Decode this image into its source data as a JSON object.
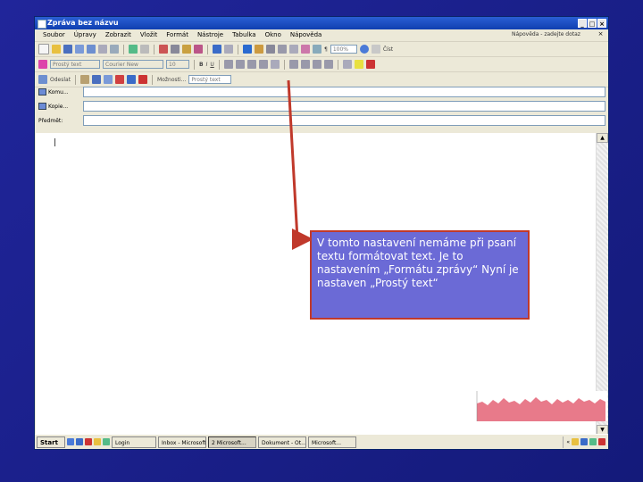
{
  "window": {
    "title": "Zpráva bez názvu",
    "buttons": [
      "_",
      "□",
      "×"
    ]
  },
  "menu": {
    "items": [
      "Soubor",
      "Úpravy",
      "Zobrazit",
      "Vložit",
      "Formát",
      "Nástroje",
      "Tabulka",
      "Okno",
      "Nápověda"
    ],
    "help_box": "Nápověda - zadejte dotaz",
    "close": "×"
  },
  "toolbar_standard": {
    "zoom": "100%",
    "read_label": "Číst",
    "pilcrow": "¶"
  },
  "toolbar_format": {
    "style": "Prostý text",
    "font": "Courier New",
    "size": "10",
    "bold": "B",
    "italic": "I",
    "underline": "U"
  },
  "toolbar_email": {
    "send": "Odeslat",
    "options": "Možnosti...",
    "format": "Prostý text"
  },
  "headers": {
    "to": "Komu...",
    "cc": "Kopie...",
    "subject": "Předmět:"
  },
  "body": {
    "cursor": "|"
  },
  "taskbar": {
    "start": "Start",
    "tasks": [
      "Login",
      "Inbox - Microsoft...",
      "2 Microsoft...",
      "Dokument - Ot...",
      "Microsoft..."
    ],
    "tray_chevron": "«"
  },
  "callout": {
    "text": "V tomto nastavení nemáme při psaní textu formátovat text. Je to nastavením „Formátu zprávy“ Nyní je nastaven „Prostý text“"
  },
  "colors": {
    "slide_background": "#1c1f8f",
    "callout_fill": "#6b6ad6",
    "callout_border": "#c0392b",
    "arrow": "#c0392b",
    "titlebar": "#0f3fb0",
    "graph_fill": "#e87a8a"
  }
}
